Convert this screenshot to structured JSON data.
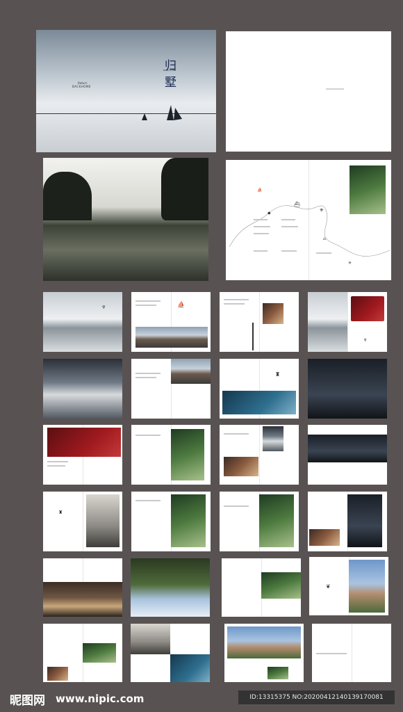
{
  "cover": {
    "title_char1": "归",
    "title_char2": "墅",
    "subtitle": "BACK HOME",
    "brand_line1": "Return",
    "brand_line2": "BACKHOME"
  },
  "watermark": {
    "site_logo": "昵图网",
    "site_url": "www.nipic.com",
    "image_id": "ID:13315375 NO:20200412140139170081"
  },
  "colors": {
    "background": "#585352",
    "page": "#ffffff"
  }
}
